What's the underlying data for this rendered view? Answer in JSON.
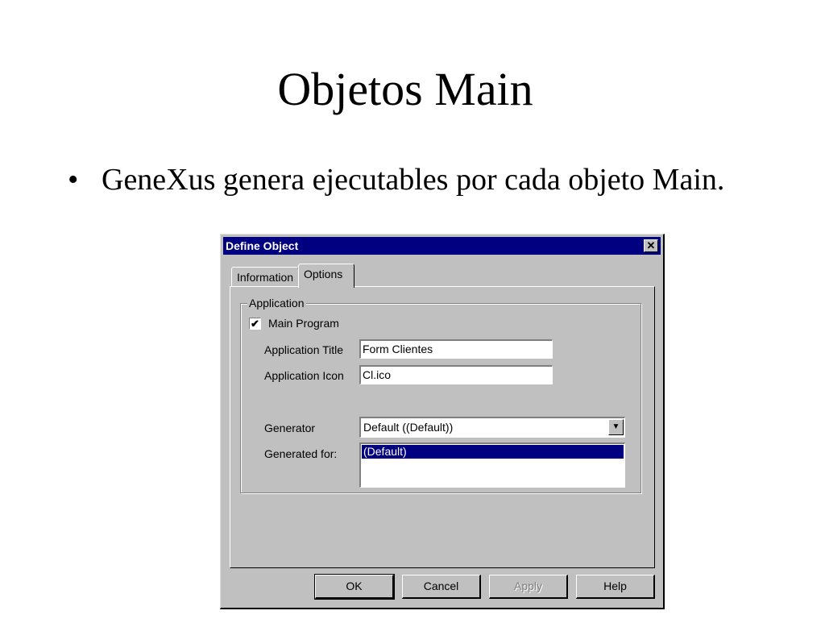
{
  "slide": {
    "title": "Objetos Main",
    "bullet_marker": "•",
    "bullet_text": "GeneXus genera ejecutables por cada objeto Main."
  },
  "dialog": {
    "title": "Define Object",
    "close_glyph": "✕",
    "tabs": [
      {
        "label": "Information",
        "active": false
      },
      {
        "label": "Options",
        "active": true
      }
    ],
    "group": {
      "label": "Application",
      "main_program": {
        "label": "Main Program",
        "checked": true,
        "check_glyph": "✔"
      },
      "application_title": {
        "label": "Application Title",
        "value": "Form Clientes"
      },
      "application_icon": {
        "label": "Application Icon",
        "value": "Cl.ico"
      },
      "generator": {
        "label": "Generator",
        "value": "Default ((Default))",
        "arrow_glyph": "▼"
      },
      "generated_for": {
        "label": "Generated for:",
        "items": [
          "(Default)"
        ]
      }
    },
    "buttons": {
      "ok": "OK",
      "cancel": "Cancel",
      "apply": "Apply",
      "help": "Help"
    }
  },
  "colors": {
    "titlebar": "#000080",
    "dialog_face": "#c0c0c0",
    "selection": "#000080"
  }
}
